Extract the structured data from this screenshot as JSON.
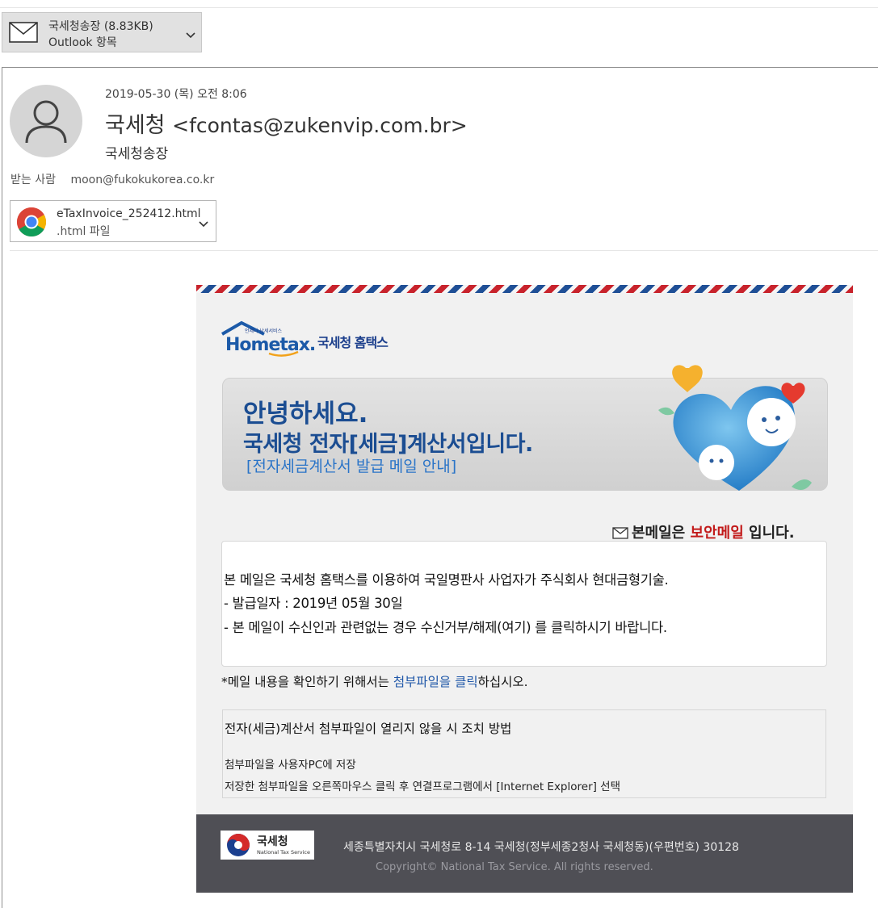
{
  "item": {
    "title": "국세청송장 (8.83KB)",
    "type": "Outlook 항목"
  },
  "header": {
    "date": "2019-05-30 (목) 오전 8:06",
    "sender_name": "국세청",
    "sender_email": "<fcontas@zukenvip.com.br>",
    "subject": "국세청송장",
    "to_label": "받는 사람",
    "to_address": "moon@fukokukorea.co.kr"
  },
  "attachment": {
    "filename": "eTaxInvoice_252412.html",
    "filetype": ".html 파일"
  },
  "body": {
    "logo_text": "Hometax.",
    "logo_tagline": "언제나 납세서비스",
    "logo_sub": "국세청 홈택스",
    "banner_hello": "안녕하세요.",
    "banner_title": "국세청 전자[세금]계산서입니다.",
    "banner_sub": "[전자세금계산서 발급 메일 안내]",
    "secure_prefix": "본메일은 ",
    "secure_highlight": "보안메일",
    "secure_suffix": " 입니다.",
    "line1": "본 메일은 국세청 홈택스를 이용하여 국일명판사 사업자가 주식회사 현대금형기술.",
    "line2": "- 발급일자 : 2019년 05월 30일",
    "line3": "- 본 메일이 수신인과 관련없는 경우 수신거부/해제(여기) 를 클릭하시기 바랍니다.",
    "click_prefix": "*메일 내용을 확인하기 위해서는 ",
    "click_link": "첨부파일을 클릭",
    "click_suffix": "하십시오.",
    "help_title": "전자(세금)계산서 첨부파일이 열리지 않을 시 조치 방법",
    "help_step1": "첨부파일을 사용자PC에 저장",
    "help_step2": "저장한 첨부파일을 오른쪽마우스 클릭 후 연결프로그램에서 [Internet Explorer] 선택"
  },
  "footer": {
    "logo_ko": "국세청",
    "logo_en": "National Tax Service",
    "address": "세종특별자치시 국세청로 8-14 국세청(정부세종2청사 국세청동)(우편번호) 30128",
    "copyright": "Copyright© National Tax Service. All rights reserved."
  },
  "colors": {
    "brand_blue": "#1b4d92",
    "link_blue": "#1e56a8",
    "secure_red": "#c21a1a",
    "footer_bg": "#4f4f55"
  },
  "icons": {
    "item": "envelope-icon",
    "attachment": "chrome-icon",
    "expand": "chevron-down-icon",
    "avatar": "person-icon"
  }
}
